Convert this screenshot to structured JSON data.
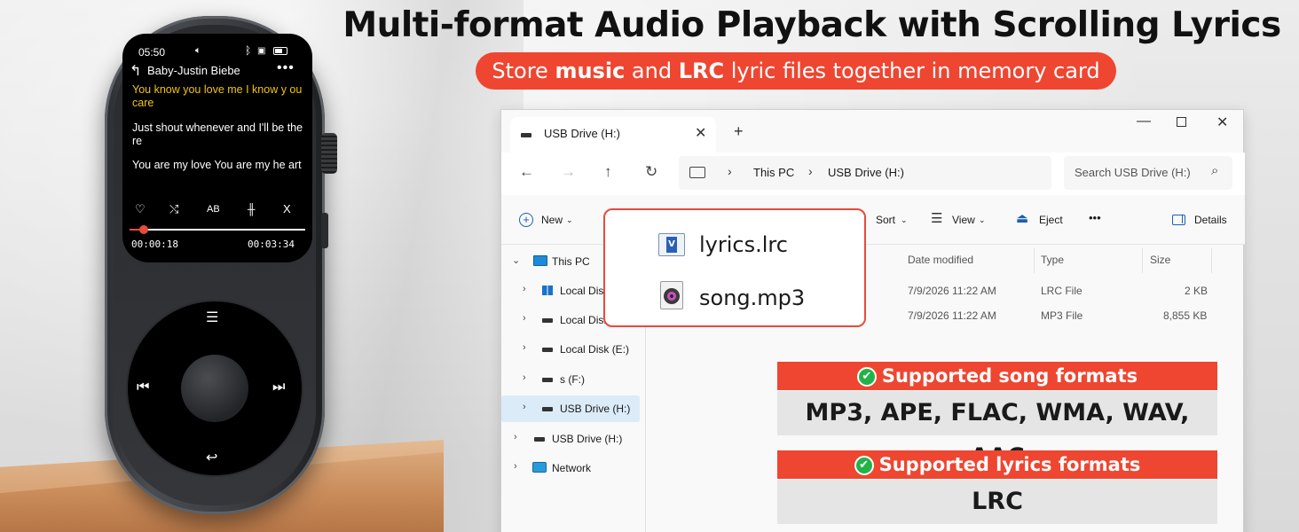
{
  "headline": {
    "title": "Multi-format Audio Playback with Scrolling Lyrics",
    "banner_pre": "Store ",
    "banner_b1": "music",
    "banner_mid": " and ",
    "banner_b2": "LRC",
    "banner_post": " lyric files together in memory card"
  },
  "player": {
    "status_time": "05:50",
    "song_title": "Baby-Justin Biebe",
    "more": "•••",
    "lyrics": [
      "You know you love me I know y ou care",
      "Just shout whenever and I'll be there",
      "You are my love You are my he art"
    ],
    "ctrl_ab": "AB",
    "ctrl_x": "X",
    "progress": 0.08,
    "time_current": "00:00:18",
    "time_total": "00:03:34"
  },
  "explorer": {
    "tab_label": "USB Drive (H:)",
    "tab_close": "✕",
    "tab_add": "+",
    "breadcrumb": [
      "This PC",
      "USB Drive (H:)"
    ],
    "search_placeholder": "Search USB Drive (H:)",
    "toolbar": {
      "new": "New",
      "sort": "Sort",
      "view": "View",
      "eject": "Eject",
      "more": "•••",
      "details": "Details"
    },
    "nav_items": [
      {
        "label": "This PC"
      },
      {
        "label": "Local Disk"
      },
      {
        "label": "Local Disk"
      },
      {
        "label": "Local Disk (E:)"
      },
      {
        "label": "s (F:)"
      },
      {
        "label": "USB Drive (H:)"
      },
      {
        "label": "USB Drive (H:)"
      },
      {
        "label": "Network"
      }
    ],
    "columns": [
      "Date modified",
      "Type",
      "Size"
    ],
    "files": [
      {
        "name": "lyrics.lrc",
        "date": "7/9/2026 11:22 AM",
        "type": "LRC File",
        "size": "2 KB"
      },
      {
        "name": "song.mp3",
        "date": "7/9/2026 11:22 AM",
        "type": "MP3 File",
        "size": "8,855 KB"
      }
    ]
  },
  "formats": {
    "song_heading": "Supported song formats",
    "song_list": "MP3, APE, FLAC, WMA, WAV, AAC",
    "lyrics_heading": "Supported lyrics formats",
    "lyrics_list": "LRC"
  },
  "colors": {
    "accent_red": "#ee4631",
    "check_green": "#23b24a",
    "lyric_highlight": "#f1c40f",
    "selection_blue": "#dcebf8"
  }
}
